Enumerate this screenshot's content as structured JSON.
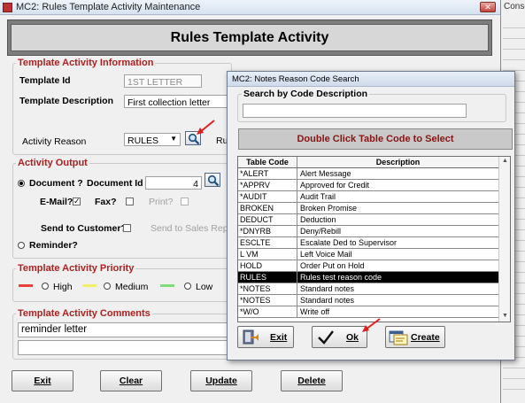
{
  "main_window": {
    "title": "MC2: Rules Template Activity Maintenance",
    "heading": "Rules Template Activity",
    "info_group": {
      "legend": "Template Activity Information",
      "template_id_label": "Template Id",
      "template_id_value": "1ST LETTER",
      "template_desc_label": "Template Description",
      "template_desc_value": "First collection letter",
      "activity_reason_label": "Activity Reason",
      "activity_reason_value": "RULES",
      "cut_label": "Ru"
    },
    "output_group": {
      "legend": "Activity Output",
      "document_label": "Document ?",
      "document_id_label": "Document Id",
      "document_id_value": "4",
      "email_label": "E-Mail?",
      "fax_label": "Fax?",
      "print_label": "Print?",
      "send_customer_label": "Send to Customer?",
      "send_sales_label": "Send to Sales Rep?",
      "reminder_label": "Reminder?"
    },
    "priority_group": {
      "legend": "Template Activity Priority",
      "high_label": "High",
      "medium_label": "Medium",
      "low_label": "Low",
      "high_color": "#e8433b",
      "medium_color": "#f4ef6a",
      "low_color": "#7ddc73"
    },
    "comments_group": {
      "legend": "Template Activity Comments",
      "line1": "reminder letter",
      "line2": ""
    },
    "buttons": {
      "exit": "Exit",
      "clear": "Clear",
      "update": "Update",
      "delete": "Delete"
    }
  },
  "background_window": {
    "title_fragment": "Consolo"
  },
  "dialog": {
    "title": "MC2: Notes Reason Code Search",
    "search_label": "Search by Code Description",
    "search_value": "",
    "banner": "Double Click Table Code to Select",
    "columns": [
      "Table Code",
      "Description"
    ],
    "rows": [
      {
        "code": "*ALERT",
        "desc": "Alert Message",
        "selected": false
      },
      {
        "code": "*APPRV",
        "desc": "Approved for Credit",
        "selected": false
      },
      {
        "code": "*AUDIT",
        "desc": "Audit Trail",
        "selected": false
      },
      {
        "code": "BROKEN",
        "desc": "Broken Promise",
        "selected": false
      },
      {
        "code": "DEDUCT",
        "desc": "Deduction",
        "selected": false
      },
      {
        "code": "*DNYRB",
        "desc": "Deny/Rebill",
        "selected": false
      },
      {
        "code": "ESCLTE",
        "desc": "Escalate Ded to Supervisor",
        "selected": false
      },
      {
        "code": "L VM",
        "desc": "Left Voice Mail",
        "selected": false
      },
      {
        "code": "HOLD",
        "desc": "Order Put on Hold",
        "selected": false
      },
      {
        "code": "RULES",
        "desc": "Rules test reason code",
        "selected": true
      },
      {
        "code": "*NOTES",
        "desc": "Standard notes",
        "selected": false
      },
      {
        "code": "*NOTES",
        "desc": "Standard notes",
        "selected": false
      },
      {
        "code": "*W/O",
        "desc": "Write off",
        "selected": false
      }
    ],
    "buttons": {
      "exit": "Exit",
      "ok": "Ok",
      "create": "Create"
    }
  }
}
